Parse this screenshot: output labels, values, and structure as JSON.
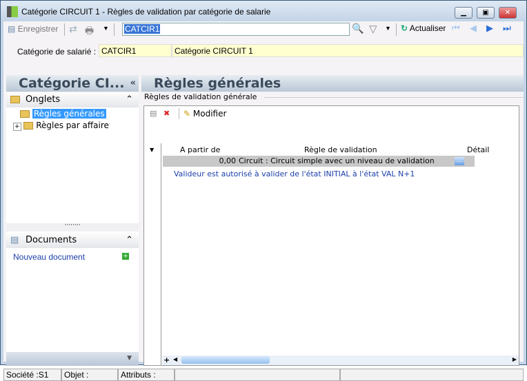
{
  "window": {
    "title": "Catégorie CIRCUIT 1 -  Règles de validation par catégorie de salarie"
  },
  "toolbar": {
    "save_label": "Enregistrer",
    "search_value": "CATCIR1",
    "refresh_label": "Actualiser"
  },
  "header": {
    "label": "Catégorie de salarié :",
    "code": "CATCIR1",
    "name": "Catégorie CIRCUIT 1"
  },
  "sidebar": {
    "title": "Catégorie CI...",
    "collapse": "«",
    "onglets": "Onglets",
    "tree": [
      {
        "label": "Règles générales"
      },
      {
        "label": "Règles par affaire"
      }
    ],
    "documents": "Documents",
    "new_document": "Nouveau document"
  },
  "main": {
    "title": "Règles générales",
    "group": "Règles de validation générale",
    "modify_label": "Modifier",
    "columns": [
      "A partir de",
      "Règle de validation",
      "Détail"
    ],
    "rows": [
      {
        "from": "0,00",
        "rule": "Circuit : Circuit simple avec un niveau de validation",
        "detail": "..."
      }
    ],
    "detail_line": "Valideur  est autorisé à valider de l'état INITIAL à l'état VAL N+1"
  },
  "status": {
    "company": "Société :S1",
    "object": "Objet :",
    "attributes": "Attributs :"
  }
}
